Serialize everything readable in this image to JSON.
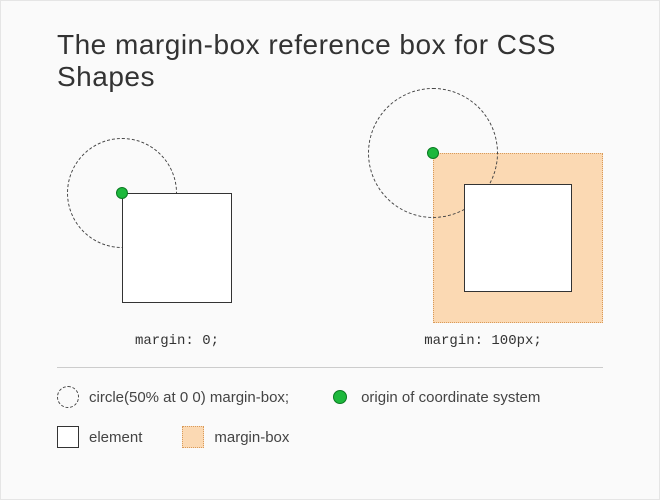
{
  "title": "The margin-box reference box for CSS Shapes",
  "examples": {
    "left": {
      "caption": "margin: 0;"
    },
    "right": {
      "caption": "margin: 100px;"
    }
  },
  "legend": {
    "circle": "circle(50% at 0 0) margin-box;",
    "origin": "origin of coordinate system",
    "element": "element",
    "marginbox": "margin-box"
  },
  "colors": {
    "accent": "#1db83c",
    "marginFill": "#fbd9b3",
    "marginBorder": "#d89a5a"
  }
}
